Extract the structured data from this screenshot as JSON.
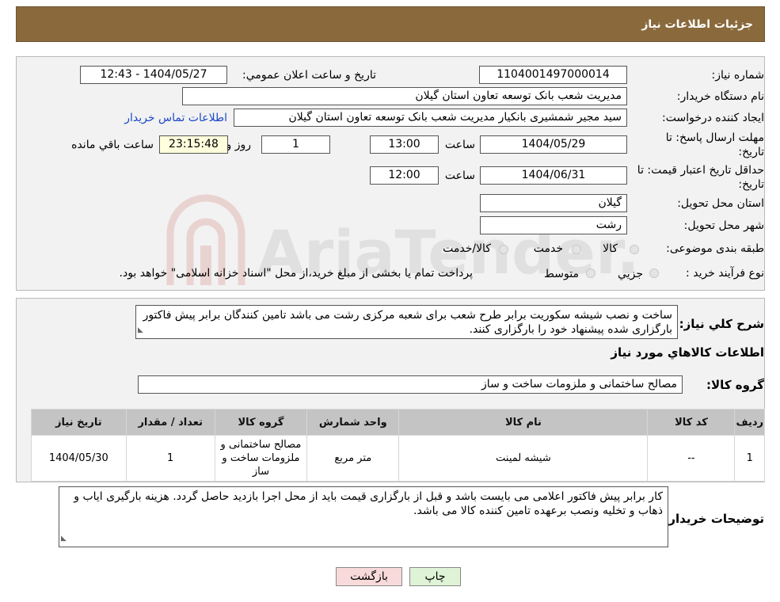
{
  "header": {
    "title": "جزئیات اطلاعات نیاز"
  },
  "form": {
    "need_number_label": "شماره نیاز:",
    "need_number": "1104001497000014",
    "announce_label": "تاریخ و ساعت اعلان عمومي:",
    "announce_value": "1404/05/27 - 12:43",
    "buyer_org_label": "نام دستگاه خریدار:",
    "buyer_org": "مدیریت شعب بانک توسعه تعاون استان گیلان",
    "creator_label": "ایجاد کننده درخواست:",
    "creator": "سید مجیر شمشیری بانکیار مدیریت شعب بانک توسعه تعاون استان گیلان",
    "contact_link": "اطلاعات تماس خریدار",
    "deadline_label_1": "مهلت ارسال پاسخ: تا",
    "deadline_label_2": "تاریخ:",
    "deadline_date": "1404/05/29",
    "time_word": "ساعت",
    "deadline_time": "13:00",
    "days_value": "1",
    "days_label": "روز و",
    "remaining_time": "23:15:48",
    "remaining_label": "ساعت باقي مانده",
    "validity_label_1": "حداقل تاریخ اعتبار قیمت: تا",
    "validity_label_2": "تاریخ:",
    "validity_date": "1404/06/31",
    "validity_time": "12:00",
    "province_label": "استان محل تحویل:",
    "province": "گیلان",
    "city_label": "شهر محل تحویل:",
    "city": "رشت",
    "category_label": "طبقه بندی موضوعی:",
    "category_options": [
      "کالا",
      "خدمت",
      "کالا/خدمت"
    ],
    "process_label": "نوع فرآیند خرید :",
    "process_options": [
      "جزیي",
      "متوسط"
    ],
    "process_note": "پرداخت تمام یا بخشی از مبلغ خرید،از محل \"اسناد خزانه اسلامی\" خواهد بود."
  },
  "description": {
    "label": "شرح کلي نیاز:",
    "text": "ساخت و نصب شیشه سکوریت برابر طرح شعب برای شعبه مرکزی رشت می باشد تامین کنندگان برابر پیش فاکتور بارگزاری شده پیشنهاد خود را بارگزاری کنند.",
    "items_title": "اطلاعات کالاهاي مورد نیاز",
    "group_label": "گروه کالا:",
    "group_value": "مصالح ساختمانی و ملزومات ساخت و ساز"
  },
  "table": {
    "headers": [
      "ردیف",
      "کد کالا",
      "نام کالا",
      "واحد شمارش",
      "گروه کالا",
      "تعداد / مقدار",
      "تاریخ نیاز"
    ],
    "rows": [
      [
        "1",
        "--",
        "شیشه لمینت",
        "متر مربع",
        "مصالح ساختمانی و ملزومات ساخت و ساز",
        "1",
        "1404/05/30"
      ]
    ]
  },
  "buyer_notes": {
    "label": "توضیحات خریدار:",
    "text": "کار برابر پیش فاکتور اعلامی می بایست باشد و قبل از بارگزاری قیمت باید از محل اجرا بازدید حاصل گردد. هزینه بارگیری ایاب و ذهاب و تخلیه ونصب برعهده تامین کننده کالا می باشد."
  },
  "buttons": {
    "print": "چاپ",
    "back": "بازگشت"
  },
  "watermark": {
    "text": "AriaTender.neT"
  },
  "colors": {
    "header_bg": "#8a6a3c",
    "link": "#1a49c8",
    "print_btn": "#dff3d6",
    "back_btn": "#f8dada",
    "time_bg": "#ffffdd"
  }
}
